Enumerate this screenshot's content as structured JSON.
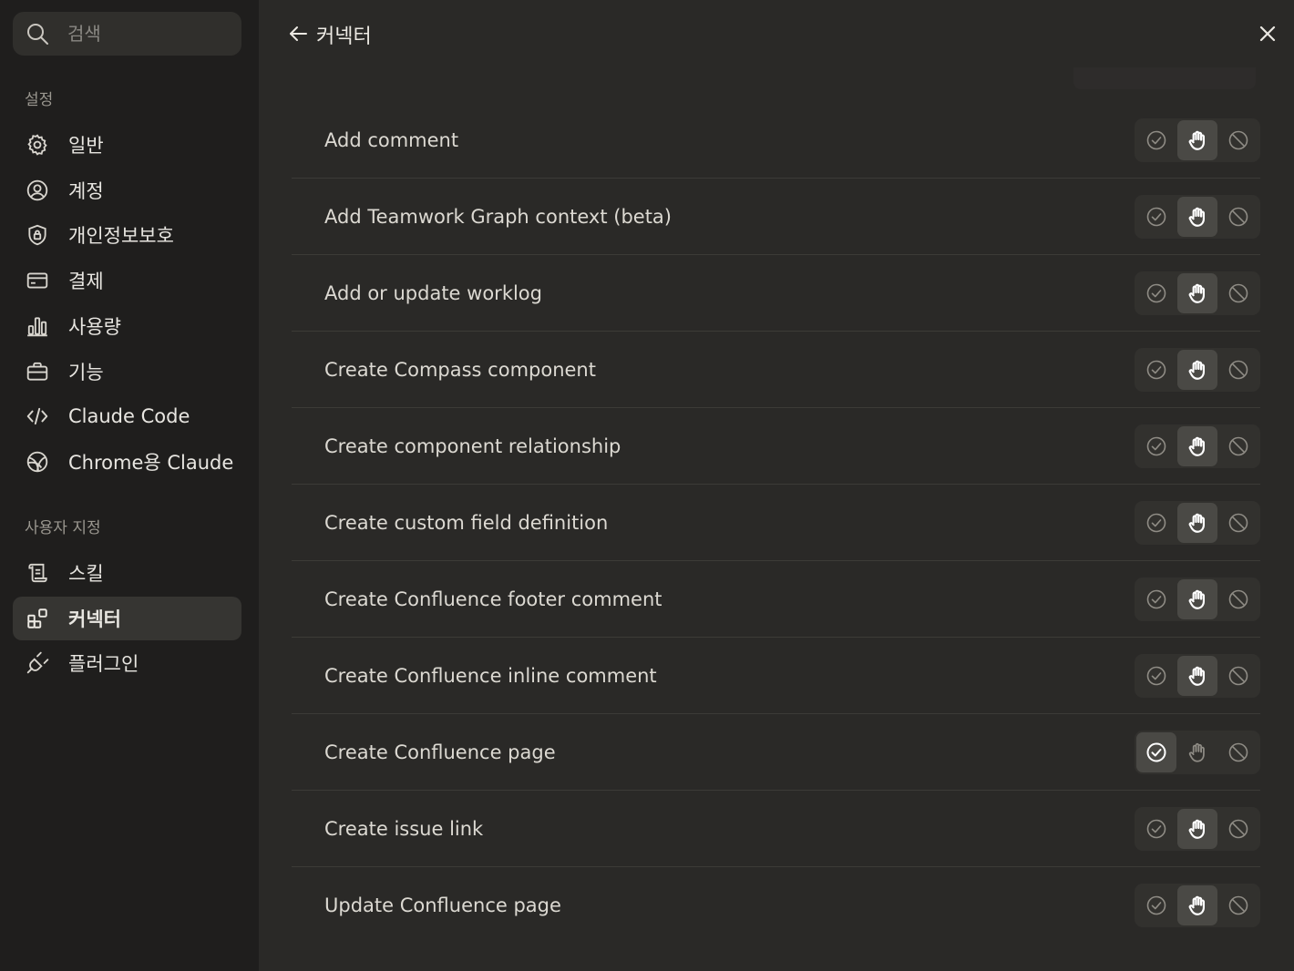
{
  "search": {
    "placeholder": "검색"
  },
  "sections": {
    "settings": "설정",
    "customize": "사용자 지정"
  },
  "nav_settings": [
    {
      "label": "일반",
      "icon": "gear-icon"
    },
    {
      "label": "계정",
      "icon": "user-circle-icon"
    },
    {
      "label": "개인정보보호",
      "icon": "shield-lock-icon"
    },
    {
      "label": "결제",
      "icon": "credit-card-icon"
    },
    {
      "label": "사용량",
      "icon": "bar-chart-icon"
    },
    {
      "label": "기능",
      "icon": "briefcase-icon"
    },
    {
      "label": "Claude Code",
      "icon": "code-icon"
    },
    {
      "label": "Chrome용 Claude",
      "icon": "globe-icon"
    }
  ],
  "nav_customize": [
    {
      "label": "스킬",
      "icon": "scroll-icon"
    },
    {
      "label": "커넥터",
      "icon": "connector-icon",
      "active": true
    },
    {
      "label": "플러그인",
      "icon": "plug-icon"
    }
  ],
  "header": {
    "title": "커넥터"
  },
  "tools": [
    {
      "name": "Add comment",
      "permission": "ask"
    },
    {
      "name": "Add Teamwork Graph context (beta)",
      "permission": "ask"
    },
    {
      "name": "Add or update worklog",
      "permission": "ask"
    },
    {
      "name": "Create Compass component",
      "permission": "ask"
    },
    {
      "name": "Create component relationship",
      "permission": "ask"
    },
    {
      "name": "Create custom field definition",
      "permission": "ask"
    },
    {
      "name": "Create Confluence footer comment",
      "permission": "ask"
    },
    {
      "name": "Create Confluence inline comment",
      "permission": "ask"
    },
    {
      "name": "Create Confluence page",
      "permission": "allow"
    },
    {
      "name": "Create issue link",
      "permission": "ask"
    },
    {
      "name": "Update Confluence page",
      "permission": "ask"
    }
  ],
  "colors": {
    "sidebar_bg": "#1f1e1d",
    "main_bg": "#2a2927",
    "active_bg": "#363532",
    "text": "#e8e6e1"
  }
}
